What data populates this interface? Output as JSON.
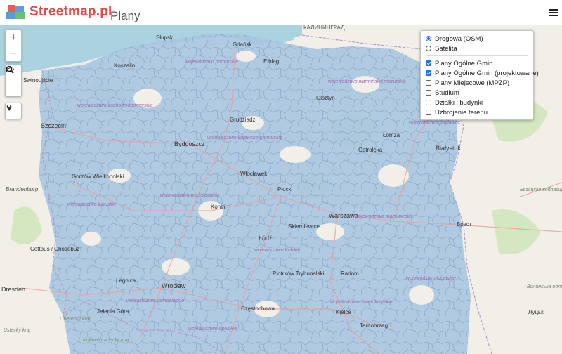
{
  "header": {
    "brand": "Streetmap.pl",
    "subtitle": "Plany"
  },
  "colors": {
    "brand": "#e04a4a",
    "sea": "#aad3df",
    "land": "#f2efe9",
    "plan_fill": "#a7c4e0",
    "plan_stroke": "#6f93bd",
    "forest": "#cce3b7",
    "accent": "#1a73e8"
  },
  "controls": {
    "zoom_in": "+",
    "zoom_out": "−"
  },
  "layers": {
    "base": [
      {
        "label": "Drogowa (OSM)",
        "selected": true
      },
      {
        "label": "Satelita",
        "selected": false
      }
    ],
    "overlays": [
      {
        "label": "Plany Ogólne Gmin",
        "checked": true
      },
      {
        "label": "Plany Ogólne Gmin (projektowane)",
        "checked": true
      },
      {
        "label": "Plany Miejscowe (MPZP)",
        "checked": false
      },
      {
        "label": "Studium",
        "checked": false
      },
      {
        "label": "Działki i budynki",
        "checked": false
      },
      {
        "label": "Uzbrojenie terenu",
        "checked": false
      }
    ]
  },
  "map_labels": {
    "kaliningrad": "КАЛИНИНГРАД",
    "slupsk": "Słupsk",
    "gdansk": "Gdańsk",
    "elblag": "Elbląg",
    "koszalin": "Koszalin",
    "swinoujscie": "Świnoujście",
    "olsztyn": "Olsztyn",
    "szczecin": "Szczecin",
    "grudziadz": "Grudziądz",
    "bydgoszcz": "Bydgoszcz",
    "lomza": "Łomża",
    "ostroleka": "Ostrołęka",
    "bialystok": "Białystok",
    "wloclawek": "Włocławek",
    "gorzow": "Gorzów Wielkopolski",
    "brandenburg": "Brandenburg",
    "plock": "Płock",
    "konin": "Konin",
    "warszawa": "Warszawa",
    "skierniewice": "Skierniewice",
    "brest": "Брэст",
    "lodz": "Łódź",
    "cottbus": "Cottbus / Chóśebuz",
    "piotrkow": "Piotrków Trybunalski",
    "radom": "Radom",
    "legnica": "Legnica",
    "wroclaw": "Wrocław",
    "dresden": "Dresden",
    "czestochowa": "Częstochowa",
    "kielce": "Kielce",
    "jelenia": "Jelenia Góra",
    "tarnobrzeg": "Tarnobrzeg",
    "lutsk": "Луцьк",
    "brest_obl": "Брэсцкая вобласць",
    "volyn": "Волинська область",
    "liberecky": "Liberecký kraj",
    "ustecky": "Ústecký kraj",
    "kralovehradecky": "Královéhradecký kraj",
    "woj_pomorskie": "województwo pomorskie",
    "woj_warminsko": "województwo warmińsko-mazurskie",
    "woj_zachodnio": "województwo zachodniopomorskie",
    "woj_kujawsko": "województwo kujawsko-pomorskie",
    "woj_podlaskie": "województwo podlaskie",
    "woj_lubuskie": "województwo lubuskie",
    "woj_wielkopolskie": "województwo wielkopolskie",
    "woj_mazowieckie": "województwo mazowieckie",
    "woj_lodzkie": "województwo łódzkie",
    "woj_dolnoslaskie": "województwo dolnośląskie",
    "woj_lubelskie": "województwo lubelskie",
    "woj_swietokrzyskie": "województwo świętokrzyskie",
    "woj_opolskie": "województwo opolskie"
  }
}
